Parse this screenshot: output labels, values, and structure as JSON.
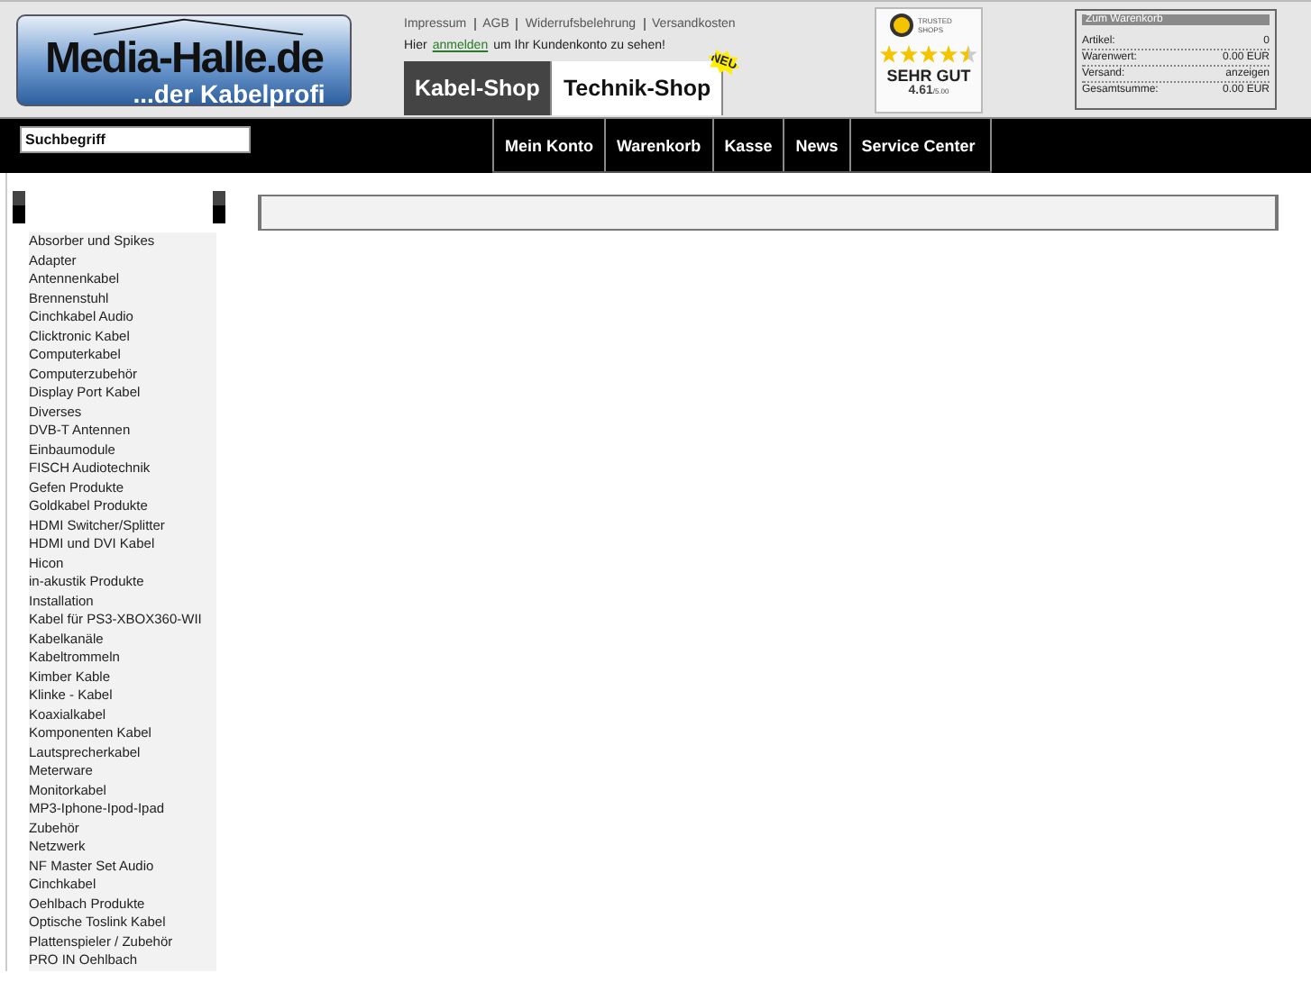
{
  "logo": {
    "title": "Media-Halle.de",
    "slogan": "...der Kabelprofi"
  },
  "top_links": [
    "Impressum",
    "AGB",
    "Widerrufsbelehrung",
    "Versandkosten"
  ],
  "login_hint": {
    "before": "Hier",
    "link": "anmelden",
    "after": "um Ihr Kundenkonto zu sehen!"
  },
  "shop_tabs": [
    {
      "label": "Kabel-Shop",
      "selected": true
    },
    {
      "label": "Technik-Shop",
      "selected": false,
      "badge": "NEU"
    }
  ],
  "trust_badge": {
    "brand": "TRUSTED SHOPS",
    "stars": 4.5,
    "rating": "SEHR GUT",
    "score": "4.61",
    "scale": "/5.00"
  },
  "cart": {
    "title": "Zum Warenkorb",
    "rows": [
      {
        "label": "Artikel:",
        "value": "0"
      },
      {
        "label": "Warenwert:",
        "value": "0.00 EUR"
      },
      {
        "label": "Versand:",
        "value": "anzeigen"
      },
      {
        "label": "Gesamtsumme:",
        "value": "0.00 EUR"
      }
    ]
  },
  "search": {
    "placeholder": "Suchbegriff"
  },
  "nav": [
    "Mein Konto",
    "Warenkorb",
    "Kasse",
    "News",
    "Service Center"
  ],
  "categories": [
    "Absorber und Spikes",
    "Adapter",
    "Antennenkabel",
    "Brennenstuhl",
    "Cinchkabel Audio",
    "Clicktronic Kabel",
    "Computerkabel",
    "Computerzubehör",
    "Display Port Kabel",
    "Diverses",
    "DVB-T Antennen",
    "Einbaumodule",
    "FISCH Audiotechnik",
    "Gefen Produkte",
    "Goldkabel Produkte",
    "HDMI Switcher/Splitter",
    "HDMI und DVI Kabel",
    "Hicon",
    "in-akustik Produkte",
    "Installation",
    "Kabel für PS3-XBOX360-WII",
    "Kabelkanäle",
    "Kabeltrommeln",
    "Kimber Kable",
    "Klinke - Kabel",
    "Koaxialkabel",
    "Komponenten Kabel",
    "Lautsprecherkabel",
    "Meterware",
    "Monitorkabel",
    "MP3-Iphone-Ipod-Ipad Zubehör",
    "Netzwerk",
    "NF Master Set Audio Cinchkabel",
    "Oehlbach Produkte",
    "Optische Toslink Kabel",
    "Plattenspieler / Zubehör",
    "PRO IN Oehlbach"
  ]
}
